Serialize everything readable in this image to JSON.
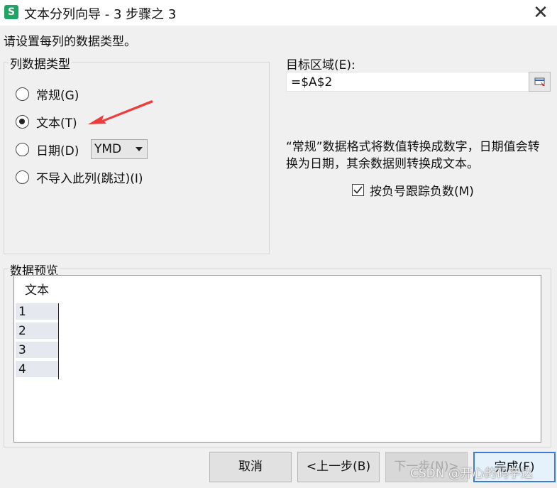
{
  "window": {
    "title": "文本分列向导 - 3 步骤之 3",
    "app_icon_letter": "S",
    "close_glyph": "✕"
  },
  "instruction": "请设置每列的数据类型。",
  "column_type": {
    "legend": "列数据类型",
    "options": [
      {
        "label": "常规(G)",
        "checked": false
      },
      {
        "label": "文本(T)",
        "checked": true
      },
      {
        "label": "日期(D)",
        "checked": false
      },
      {
        "label": "不导入此列(跳过)(I)",
        "checked": false
      }
    ],
    "date_format": "YMD"
  },
  "target": {
    "label": "目标区域(E):",
    "value": "=$A$2"
  },
  "description": "“常规”数据格式将数值转换成数字，日期值会转换为日期，其余数据则转换成文本。",
  "negative_checkbox": {
    "label": "按负号跟踪负数(M)",
    "checked": true
  },
  "preview": {
    "legend": "数据预览",
    "header": "文本",
    "rows": [
      "1",
      "2",
      "3",
      "4"
    ]
  },
  "buttons": {
    "cancel": "取消",
    "back": "<上一步(B)",
    "next": "下一步(N)>",
    "finish": "完成(F)"
  },
  "watermark": "CSDN @开心的码字达",
  "annotation": {
    "color": "#ee3b3b"
  }
}
